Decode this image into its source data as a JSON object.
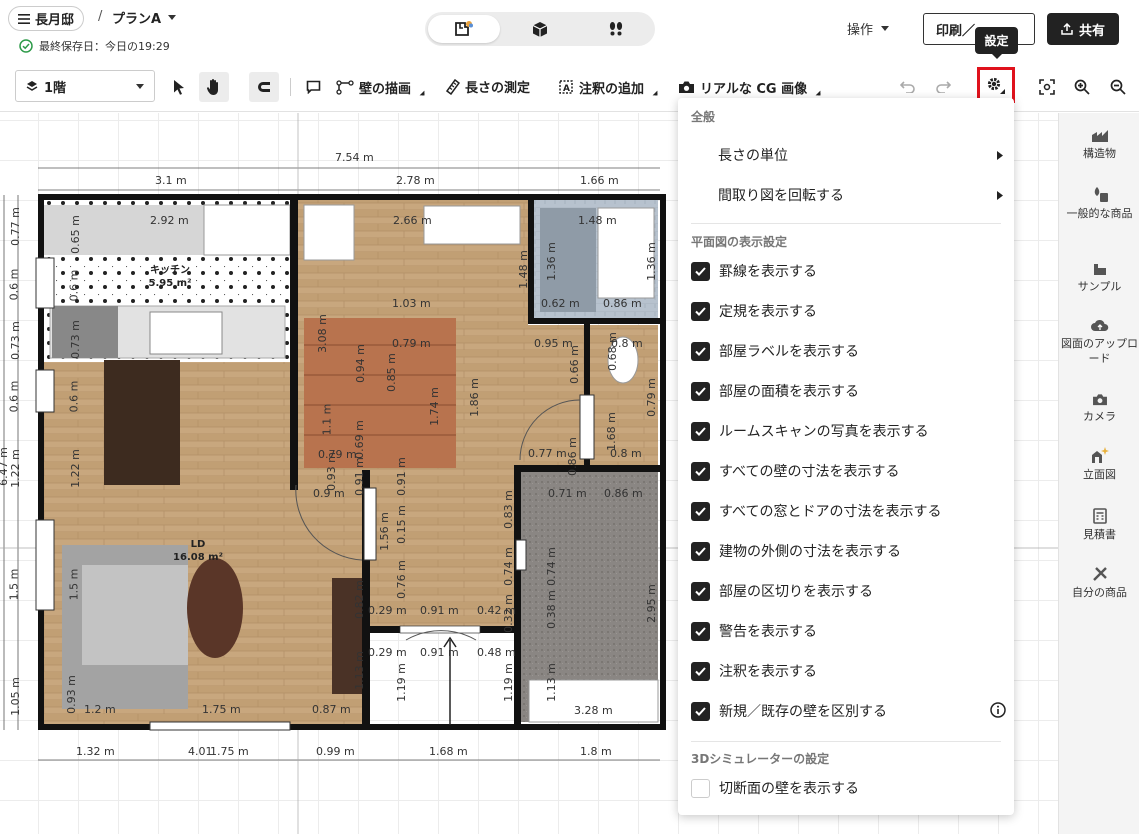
{
  "header": {
    "project_name": "長月邸",
    "separator": "/",
    "plan_name": "プランA",
    "save_status": "最終保存日：今日の19:29",
    "ops_label": "操作",
    "print_label": "印刷／",
    "share_label": "共有",
    "tooltip": "設定"
  },
  "toolbar": {
    "floor": "1階",
    "draw_wall": "壁の描画",
    "measure": "長さの測定",
    "add_note": "注釈の追加",
    "real_cg": "リアルな CG 画像"
  },
  "settings": {
    "general_header": "全般",
    "units": "長さの単位",
    "rotate": "間取り図を回転する",
    "display_header": "平面図の表示設定",
    "options": [
      {
        "label": "罫線を表示する",
        "checked": true
      },
      {
        "label": "定規を表示する",
        "checked": true
      },
      {
        "label": "部屋ラベルを表示する",
        "checked": true
      },
      {
        "label": "部屋の面積を表示する",
        "checked": true
      },
      {
        "label": "ルームスキャンの写真を表示する",
        "checked": true
      },
      {
        "label": "すべての壁の寸法を表示する",
        "checked": true
      },
      {
        "label": "すべての窓とドアの寸法を表示する",
        "checked": true
      },
      {
        "label": "建物の外側の寸法を表示する",
        "checked": true
      },
      {
        "label": "部屋の区切りを表示する",
        "checked": true
      },
      {
        "label": "警告を表示する",
        "checked": true
      },
      {
        "label": "注釈を表示する",
        "checked": true
      },
      {
        "label": "新規／既存の壁を区別する",
        "checked": true
      }
    ],
    "sim_header": "3Dシミュレーターの設定",
    "sim_options": [
      {
        "label": "切断面の壁を表示する",
        "checked": false
      }
    ]
  },
  "rail": [
    {
      "label": "構造物",
      "icon": "structure-icon"
    },
    {
      "label": "一般的な商品",
      "icon": "products-icon"
    },
    {
      "label": "サンプル",
      "icon": "sample-icon"
    },
    {
      "label": "図面のアップロード",
      "icon": "upload-icon"
    },
    {
      "label": "カメラ",
      "icon": "camera-icon"
    },
    {
      "label": "立面図",
      "icon": "elevation-icon"
    },
    {
      "label": "見積書",
      "icon": "estimate-icon"
    },
    {
      "label": "自分の商品",
      "icon": "my-products-icon"
    }
  ],
  "plan": {
    "rooms": {
      "kitchen_name": "キッチン",
      "kitchen_area": "5.95 m²",
      "ld_name": "LD",
      "ld_area": "16.08 m²"
    },
    "dims_top": [
      "7.54 m",
      "3.1 m",
      "2.78 m",
      "1.66 m"
    ],
    "dims_bottom": [
      "1.32 m",
      "4.01",
      "1.75 m",
      "0.99 m",
      "1.68 m",
      "1.8 m"
    ],
    "dims_left": [
      "0.77 m",
      "0.6 m",
      "0.73 m",
      "0.6 m",
      "1.22 m",
      "1.5 m",
      "1.05 m",
      "6.47 m"
    ],
    "dims_inner": [
      "2.92 m",
      "0.65 m",
      "0.6 m",
      "0.73 m",
      "0.6 m",
      "1.22 m",
      "1.5 m",
      "0.93 m",
      "1.2 m",
      "1.75 m",
      "0.87 m",
      "2.66 m",
      "1.48 m",
      "1.48 m",
      "1.36 m",
      "1.36 m",
      "0.62 m",
      "0.86 m",
      "1.03 m",
      "3.08 m",
      "0.94 m",
      "0.79 m",
      "1.86 m",
      "0.85 m",
      "1.74 m",
      "1.1 m",
      "0.69 m",
      "0.95 m",
      "0.66 m",
      "0.68 m",
      "0.79 m",
      "0.79 m",
      "0.8 m",
      "1.68 m",
      "0.86 m",
      "0.93 m",
      "0.77 m",
      "0.8 m",
      "0.71 m",
      "0.86 m",
      "0.9 m",
      "0.91 m",
      "0.91 m",
      "0.15 m",
      "0.83 m",
      "0.74 m",
      "0.74 m",
      "0.82 m",
      "0.76 m",
      "0.38 m",
      "2.95 m",
      "0.29 m",
      "0.91 m",
      "0.42 m",
      "0.29 m",
      "0.91 m",
      "0.48 m",
      "0.32 m",
      "1.13 m",
      "1.19 m",
      "1.19 m",
      "1.13 m",
      "1.56 m",
      "3.28 m"
    ]
  }
}
